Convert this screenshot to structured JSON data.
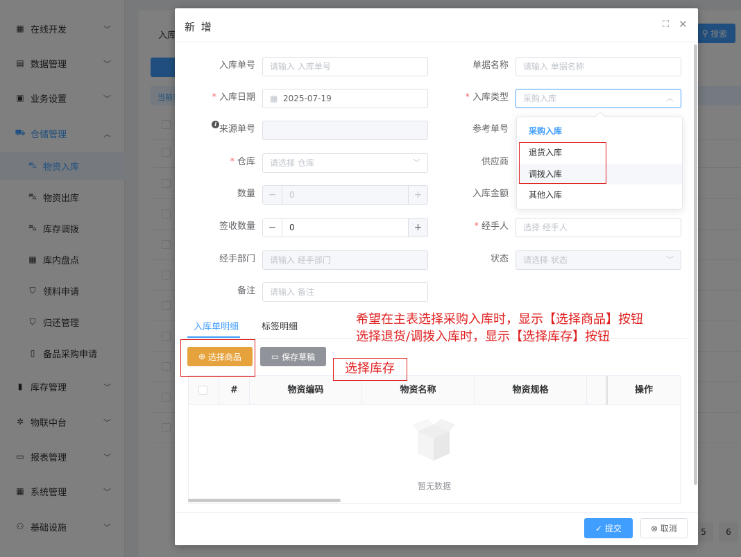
{
  "sidebar": {
    "items": [
      {
        "label": "在线开发",
        "icon": "code-icon"
      },
      {
        "label": "数据管理",
        "icon": "database-icon"
      },
      {
        "label": "业务设置",
        "icon": "briefcase-icon"
      },
      {
        "label": "仓储管理",
        "icon": "truck-icon"
      },
      {
        "label": "物资入库",
        "icon": "cart-in-icon"
      },
      {
        "label": "物资出库",
        "icon": "cart-out-icon"
      },
      {
        "label": "库存调拨",
        "icon": "cart-transfer-icon"
      },
      {
        "label": "库内盘点",
        "icon": "calendar-icon"
      },
      {
        "label": "领料申请",
        "icon": "bag-icon"
      },
      {
        "label": "归还管理",
        "icon": "bag-return-icon"
      },
      {
        "label": "备品采购申请",
        "icon": "document-icon"
      },
      {
        "label": "库存管理",
        "icon": "bar-chart-icon"
      },
      {
        "label": "物联中台",
        "icon": "gear-icon"
      },
      {
        "label": "报表管理",
        "icon": "report-icon"
      },
      {
        "label": "系统管理",
        "icon": "grid-icon"
      },
      {
        "label": "基础设施",
        "icon": "network-icon"
      }
    ]
  },
  "background": {
    "tab_label": "入库",
    "search_label": "搜索",
    "bar_label": "当前表",
    "pages": [
      "5",
      "6"
    ]
  },
  "dialog": {
    "title": "新 增",
    "max_icon": "fullscreen-icon",
    "close_icon": "close-icon",
    "fields": {
      "inbound_no": {
        "label": "入库单号",
        "placeholder": "请输入 入库单号"
      },
      "doc_name": {
        "label": "单据名称",
        "placeholder": "请输入 单据名称"
      },
      "inbound_date": {
        "label": "入库日期",
        "value": "2025-07-19"
      },
      "inbound_type": {
        "label": "入库类型",
        "placeholder": "采购入库"
      },
      "source_no": {
        "label": "来源单号"
      },
      "ref_no": {
        "label": "参考单号"
      },
      "warehouse": {
        "label": "仓库",
        "placeholder": "请选择 仓库"
      },
      "supplier": {
        "label": "供应商"
      },
      "quantity": {
        "label": "数量",
        "value": "0"
      },
      "amount": {
        "label": "入库金额"
      },
      "received_qty": {
        "label": "签收数量",
        "value": "0"
      },
      "handler": {
        "label": "经手人",
        "placeholder": "选择 经手人"
      },
      "handler_dept": {
        "label": "经手部门",
        "placeholder": "请输入 经手部门"
      },
      "status": {
        "label": "状态",
        "placeholder": "请选择 状态"
      },
      "remark": {
        "label": "备注",
        "placeholder": "请输入 备注"
      }
    },
    "dropdown_options": [
      "采购入库",
      "退货入库",
      "调拨入库",
      "其他入库"
    ],
    "tabs": [
      "入库单明细",
      "标签明细"
    ],
    "buttons": {
      "select_goods": "选择商品",
      "save_draft": "保存草稿",
      "submit": "提交",
      "cancel": "取消"
    },
    "table": {
      "headers": [
        "#",
        "物资编码",
        "物资名称",
        "物资规格",
        "操作"
      ],
      "empty_text": "暂无数据"
    }
  },
  "annotations": {
    "line1": "希望在主表选择采购入库时，显示【选择商品】按钮",
    "line2": "选择退货/调拨入库时，显示【选择库存】按钮",
    "select_stock": "选择库存"
  },
  "colors": {
    "primary": "#409eff",
    "warning": "#e6a23c",
    "annotation": "#e02020"
  }
}
